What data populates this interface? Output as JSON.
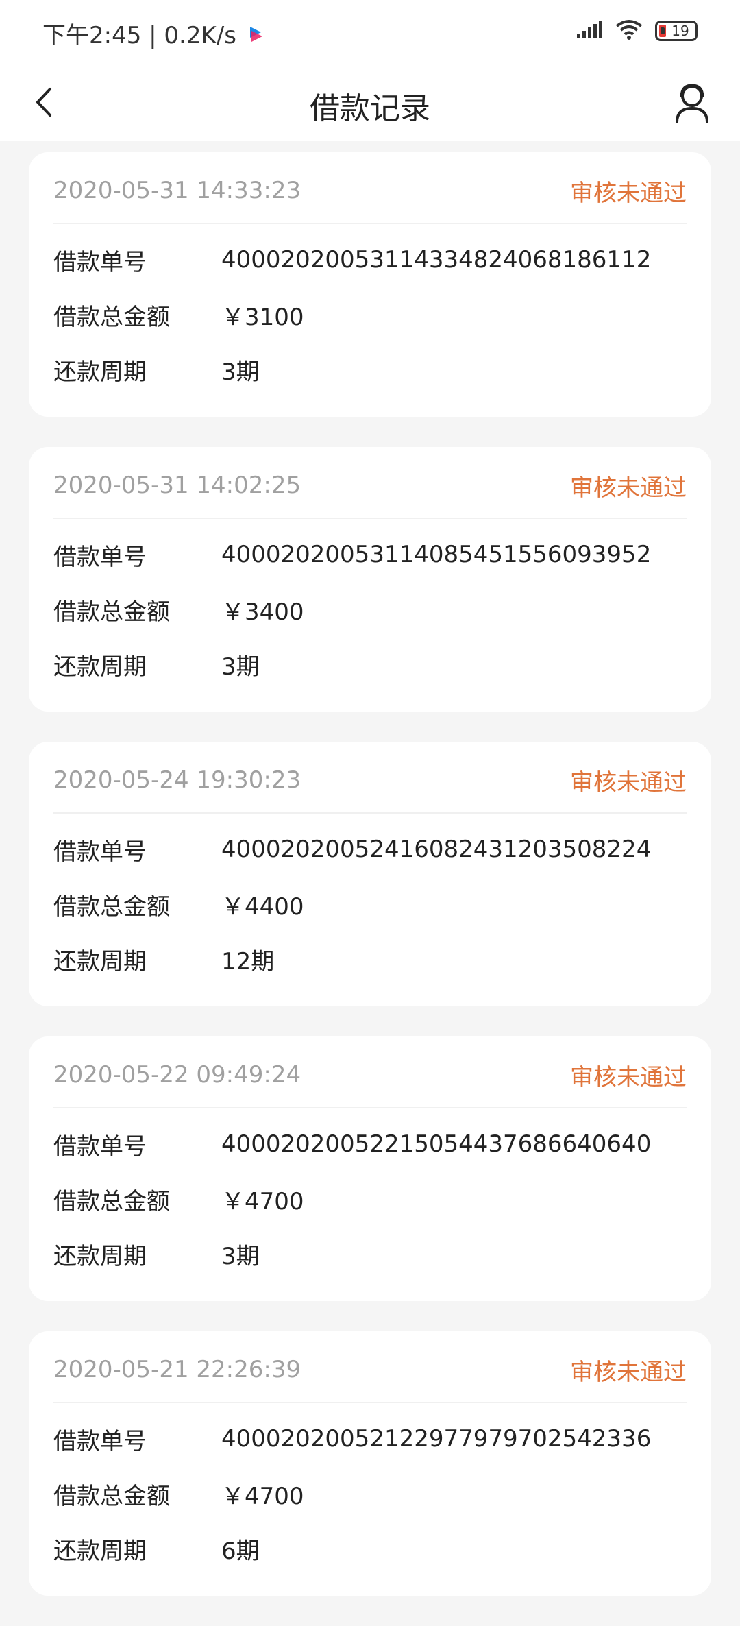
{
  "status_bar": {
    "time_speed": "下午2:45 | 0.2K/s",
    "battery_level": "19",
    "icons": [
      "signal-icon",
      "wifi-icon",
      "battery-icon"
    ]
  },
  "header": {
    "title": "借款记录",
    "back_icon": "chevron-left-icon",
    "profile_icon": "user-icon"
  },
  "labels": {
    "order_no": "借款单号",
    "total_amount": "借款总金额",
    "repay_period": "还款周期"
  },
  "records": [
    {
      "time": "2020-05-31 14:33:23",
      "status": "审核未通过",
      "order_no": "400020200531143348240681861​12",
      "amount": "￥3100",
      "period": "3期"
    },
    {
      "time": "2020-05-31 14:02:25",
      "status": "审核未通过",
      "order_no": "400020200531140854515560939​52",
      "amount": "￥3400",
      "period": "3期"
    },
    {
      "time": "2020-05-24 19:30:23",
      "status": "审核未通过",
      "order_no": "400020200524160824312035082​24",
      "amount": "￥4400",
      "period": "12期"
    },
    {
      "time": "2020-05-22 09:49:24",
      "status": "审核未通过",
      "order_no": "400020200522150544376866406​40",
      "amount": "￥4700",
      "period": "3期"
    },
    {
      "time": "2020-05-21 22:26:39",
      "status": "审核未通过",
      "order_no": "400020200521229779797025423​36",
      "amount": "￥4700",
      "period": "6期"
    }
  ],
  "colors": {
    "status_rejected": "#e0743a",
    "time_text": "#a0a0a0",
    "background": "#f5f5f5"
  }
}
